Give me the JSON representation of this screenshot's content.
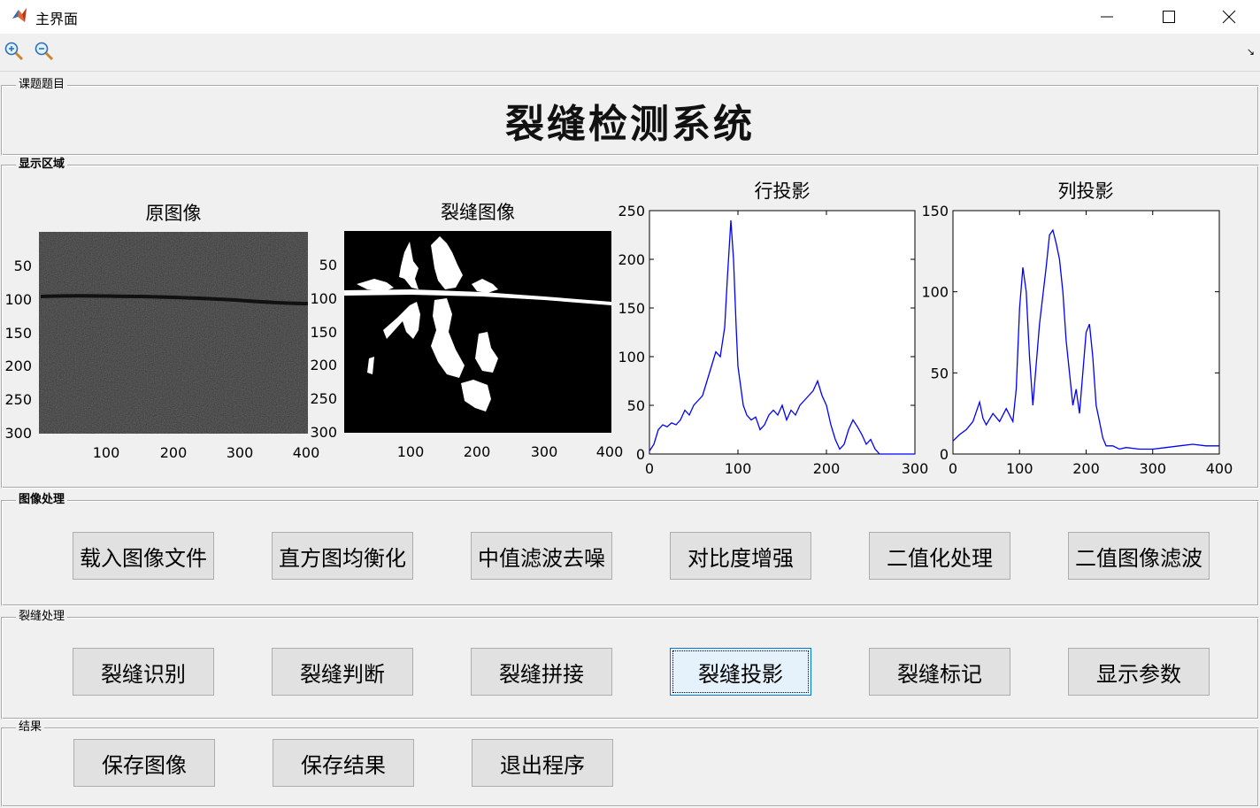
{
  "window": {
    "title": "主界面"
  },
  "toolbar": {
    "zoom_in": "zoom-in-icon",
    "zoom_out": "zoom-out-icon"
  },
  "panels": {
    "topic": {
      "label": "课题题目",
      "title": "裂缝检测系统"
    },
    "display": {
      "label": "显示区域"
    },
    "image_processing": {
      "label": "图像处理",
      "buttons": [
        "载入图像文件",
        "直方图均衡化",
        "中值滤波去噪",
        "对比度增强",
        "二值化处理",
        "二值图像滤波"
      ]
    },
    "crack_processing": {
      "label": "裂缝处理",
      "buttons": [
        "裂缝识别",
        "裂缝判断",
        "裂缝拼接",
        "裂缝投影",
        "裂缝标记",
        "显示参数"
      ]
    },
    "result": {
      "label": "结果",
      "buttons": [
        "保存图像",
        "保存结果",
        "退出程序"
      ]
    }
  },
  "plots": {
    "original": {
      "title": "原图像",
      "xticks": [
        "100",
        "200",
        "300",
        "400"
      ],
      "yticks": [
        "50",
        "100",
        "150",
        "200",
        "250",
        "300"
      ]
    },
    "crack": {
      "title": "裂缝图像",
      "xticks": [
        "100",
        "200",
        "300",
        "400"
      ],
      "yticks": [
        "50",
        "100",
        "150",
        "200",
        "250",
        "300"
      ]
    }
  },
  "chart_data": [
    {
      "type": "line",
      "title": "行投影",
      "xlim": [
        0,
        300
      ],
      "ylim": [
        0,
        250
      ],
      "xticks": [
        "0",
        "100",
        "200",
        "300"
      ],
      "yticks": [
        "0",
        "50",
        "100",
        "150",
        "200",
        "250"
      ],
      "color": "#0000ff",
      "x": [
        0,
        5,
        10,
        15,
        20,
        25,
        30,
        35,
        40,
        45,
        50,
        55,
        60,
        65,
        70,
        75,
        80,
        85,
        88,
        92,
        95,
        98,
        100,
        103,
        106,
        110,
        115,
        120,
        125,
        130,
        135,
        140,
        145,
        150,
        155,
        160,
        165,
        170,
        175,
        180,
        185,
        190,
        195,
        200,
        205,
        210,
        215,
        220,
        225,
        230,
        235,
        240,
        245,
        250,
        255,
        260,
        265,
        270,
        275,
        280,
        290,
        300
      ],
      "y": [
        3,
        10,
        25,
        30,
        28,
        32,
        30,
        35,
        45,
        40,
        50,
        55,
        60,
        75,
        90,
        105,
        100,
        130,
        180,
        240,
        200,
        130,
        90,
        70,
        50,
        40,
        35,
        38,
        25,
        30,
        40,
        45,
        40,
        50,
        35,
        45,
        40,
        50,
        55,
        60,
        65,
        75,
        60,
        50,
        30,
        15,
        5,
        10,
        25,
        35,
        28,
        20,
        10,
        15,
        5,
        0,
        0,
        0,
        0,
        0,
        0,
        0
      ]
    },
    {
      "type": "line",
      "title": "列投影",
      "xlim": [
        0,
        400
      ],
      "ylim": [
        0,
        150
      ],
      "xticks": [
        "0",
        "100",
        "200",
        "300",
        "400"
      ],
      "yticks": [
        "0",
        "50",
        "100",
        "150"
      ],
      "color": "#0000ff",
      "x": [
        0,
        10,
        20,
        30,
        40,
        45,
        50,
        60,
        70,
        80,
        90,
        95,
        100,
        105,
        110,
        115,
        120,
        130,
        140,
        145,
        150,
        155,
        160,
        165,
        170,
        180,
        185,
        190,
        200,
        205,
        210,
        215,
        220,
        225,
        230,
        240,
        250,
        260,
        280,
        300,
        320,
        340,
        360,
        380,
        400
      ],
      "y": [
        8,
        12,
        15,
        20,
        32,
        22,
        18,
        25,
        20,
        28,
        20,
        40,
        90,
        115,
        100,
        60,
        30,
        80,
        115,
        135,
        138,
        130,
        120,
        100,
        70,
        30,
        40,
        25,
        75,
        80,
        60,
        30,
        20,
        10,
        5,
        5,
        3,
        4,
        3,
        3,
        4,
        5,
        6,
        5,
        5
      ]
    }
  ]
}
